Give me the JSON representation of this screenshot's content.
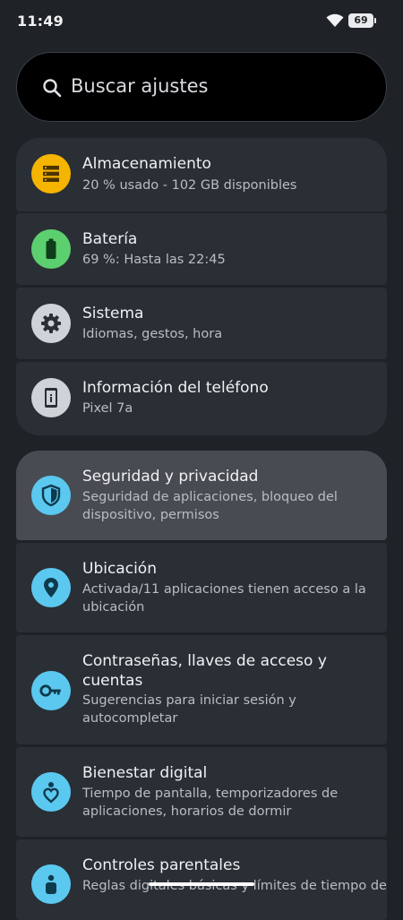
{
  "status_bar": {
    "time": "11:49",
    "battery_level": "69",
    "wifi_icon": "wifi-icon",
    "battery_icon": "battery-icon"
  },
  "search": {
    "placeholder": "Buscar ajustes",
    "icon": "search-icon"
  },
  "groups": [
    {
      "items": [
        {
          "title": "Almacenamiento",
          "subtitle": "20 % usado - 102 GB disponibles",
          "icon": "storage-icon",
          "icon_color": "#f4b400"
        },
        {
          "title": "Batería",
          "subtitle": "69 %: Hasta las 22:45",
          "icon": "battery-full-icon",
          "icon_color": "#5ccf6f"
        },
        {
          "title": "Sistema",
          "subtitle": "Idiomas, gestos, hora",
          "icon": "gear-icon",
          "icon_color": "#cfd2d7"
        },
        {
          "title": "Información del teléfono",
          "subtitle": "Pixel 7a",
          "icon": "phone-info-icon",
          "icon_color": "#cfd2d7"
        }
      ]
    },
    {
      "items": [
        {
          "title": "Seguridad y privacidad",
          "subtitle": "Seguridad de aplicaciones, bloqueo del dispositivo, permisos",
          "icon": "shield-icon",
          "icon_color": "#5bc8f0",
          "selected": true
        },
        {
          "title": "Ubicación",
          "subtitle": "Activada/11 aplicaciones tienen acceso a la ubicación",
          "icon": "location-pin-icon",
          "icon_color": "#5bc8f0"
        },
        {
          "title": "Contraseñas, llaves de acceso y cuentas",
          "subtitle": "Sugerencias para iniciar sesión y autocompletar",
          "icon": "key-icon",
          "icon_color": "#5bc8f0"
        },
        {
          "title": "Bienestar digital",
          "subtitle": "Tiempo de pantalla, temporizadores de aplicaciones, horarios de dormir",
          "icon": "heart-person-icon",
          "icon_color": "#5bc8f0"
        },
        {
          "title": "Controles parentales",
          "subtitle": "Reglas digitales básicas y límites de tiempo de",
          "icon": "child-icon",
          "icon_color": "#5bc8f0"
        }
      ]
    }
  ]
}
